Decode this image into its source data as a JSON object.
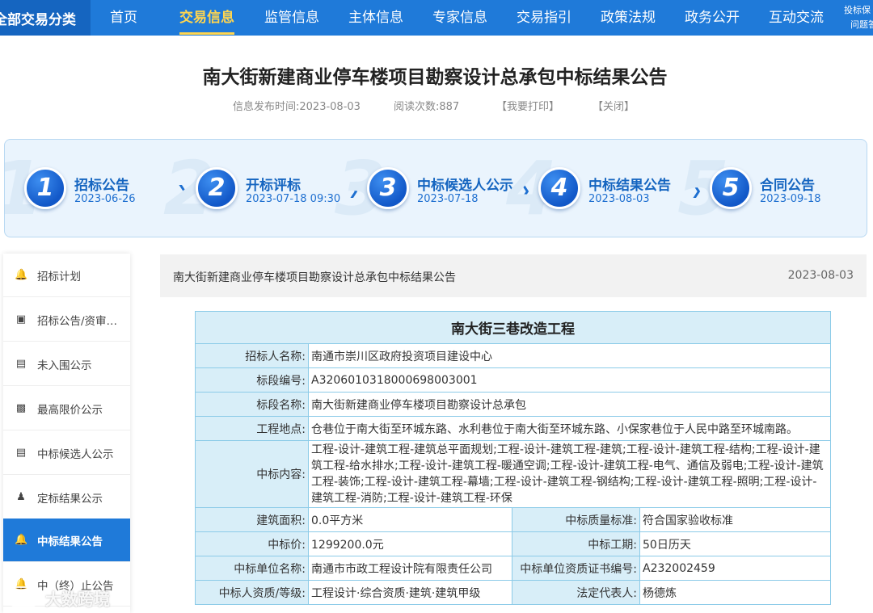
{
  "nav": {
    "category": "全部交易分类",
    "items": [
      "首页",
      "交易信息",
      "监管信息",
      "主体信息",
      "专家信息",
      "交易指引",
      "政策法规",
      "政务公开",
      "互动交流"
    ],
    "active_index": 1,
    "extra": [
      "投标保",
      "问题答"
    ]
  },
  "page": {
    "title": "南大街新建商业停车楼项目勘察设计总承包中标结果公告",
    "publish_time": "信息发布时间:2023-08-03",
    "read_count": "阅读次数:887",
    "print": "【我要打印】",
    "close": "【关闭】"
  },
  "steps": [
    {
      "num": "1",
      "name": "招标公告",
      "date": "2023-06-26"
    },
    {
      "num": "2",
      "name": "开标评标",
      "date": "2023-07-18 09:30"
    },
    {
      "num": "3",
      "name": "中标候选人公示",
      "date": "2023-07-18"
    },
    {
      "num": "4",
      "name": "中标结果公告",
      "date": "2023-08-03"
    },
    {
      "num": "5",
      "name": "合同公告",
      "date": "2023-09-18"
    }
  ],
  "sidebar": {
    "items": [
      {
        "label": "招标计划",
        "icon": "bell-icon"
      },
      {
        "label": "招标公告/资审…",
        "icon": "megaphone-icon"
      },
      {
        "label": "未入围公示",
        "icon": "briefcase-icon"
      },
      {
        "label": "最高限价公示",
        "icon": "price-tag-icon"
      },
      {
        "label": "中标候选人公示",
        "icon": "document-icon"
      },
      {
        "label": "定标结果公示",
        "icon": "person-icon"
      },
      {
        "label": "中标结果公告",
        "icon": "bell-icon"
      },
      {
        "label": "中（终）止公告",
        "icon": "bell-icon"
      }
    ],
    "active_index": 6
  },
  "content": {
    "header_title": "南大街新建商业停车楼项目勘察设计总承包中标结果公告",
    "header_date": "2023-08-03"
  },
  "table": {
    "project_name": "南大街三巷改造工程",
    "tenderer_label": "招标人名称:",
    "tenderer": "南通市崇川区政府投资项目建设中心",
    "section_no_label": "标段编号:",
    "section_no": "A3206010318000698003001",
    "section_name_label": "标段名称:",
    "section_name": "南大街新建商业停车楼项目勘察设计总承包",
    "location_label": "工程地点:",
    "location": "仓巷位于南大街至环城东路、水利巷位于南大街至环城东路、小保家巷位于人民中路至环城南路。",
    "scope_label": "中标内容:",
    "scope": "工程-设计-建筑工程-建筑总平面规划;工程-设计-建筑工程-建筑;工程-设计-建筑工程-结构;工程-设计-建筑工程-给水排水;工程-设计-建筑工程-暖通空调;工程-设计-建筑工程-电气、通信及弱电;工程-设计-建筑工程-装饰;工程-设计-建筑工程-幕墙;工程-设计-建筑工程-钢结构;工程-设计-建筑工程-照明;工程-设计-建筑工程-消防;工程-设计-建筑工程-环保",
    "area_label": "建筑面积:",
    "area": "0.0平方米",
    "quality_label": "中标质量标准:",
    "quality": "符合国家验收标准",
    "price_label": "中标价:",
    "price": "1299200.0元",
    "period_label": "中标工期:",
    "period": "50日历天",
    "winner_label": "中标单位名称:",
    "winner": "南通市市政工程设计院有限责任公司",
    "cert_label": "中标单位资质证书编号:",
    "cert": "A232002459",
    "qualification_label": "中标人资质/等级:",
    "qualification": "工程设计·综合资质·建筑·建筑甲级",
    "legal_rep_label": "法定代表人:",
    "legal_rep": "杨德炼"
  },
  "watermark": "大数跨境"
}
